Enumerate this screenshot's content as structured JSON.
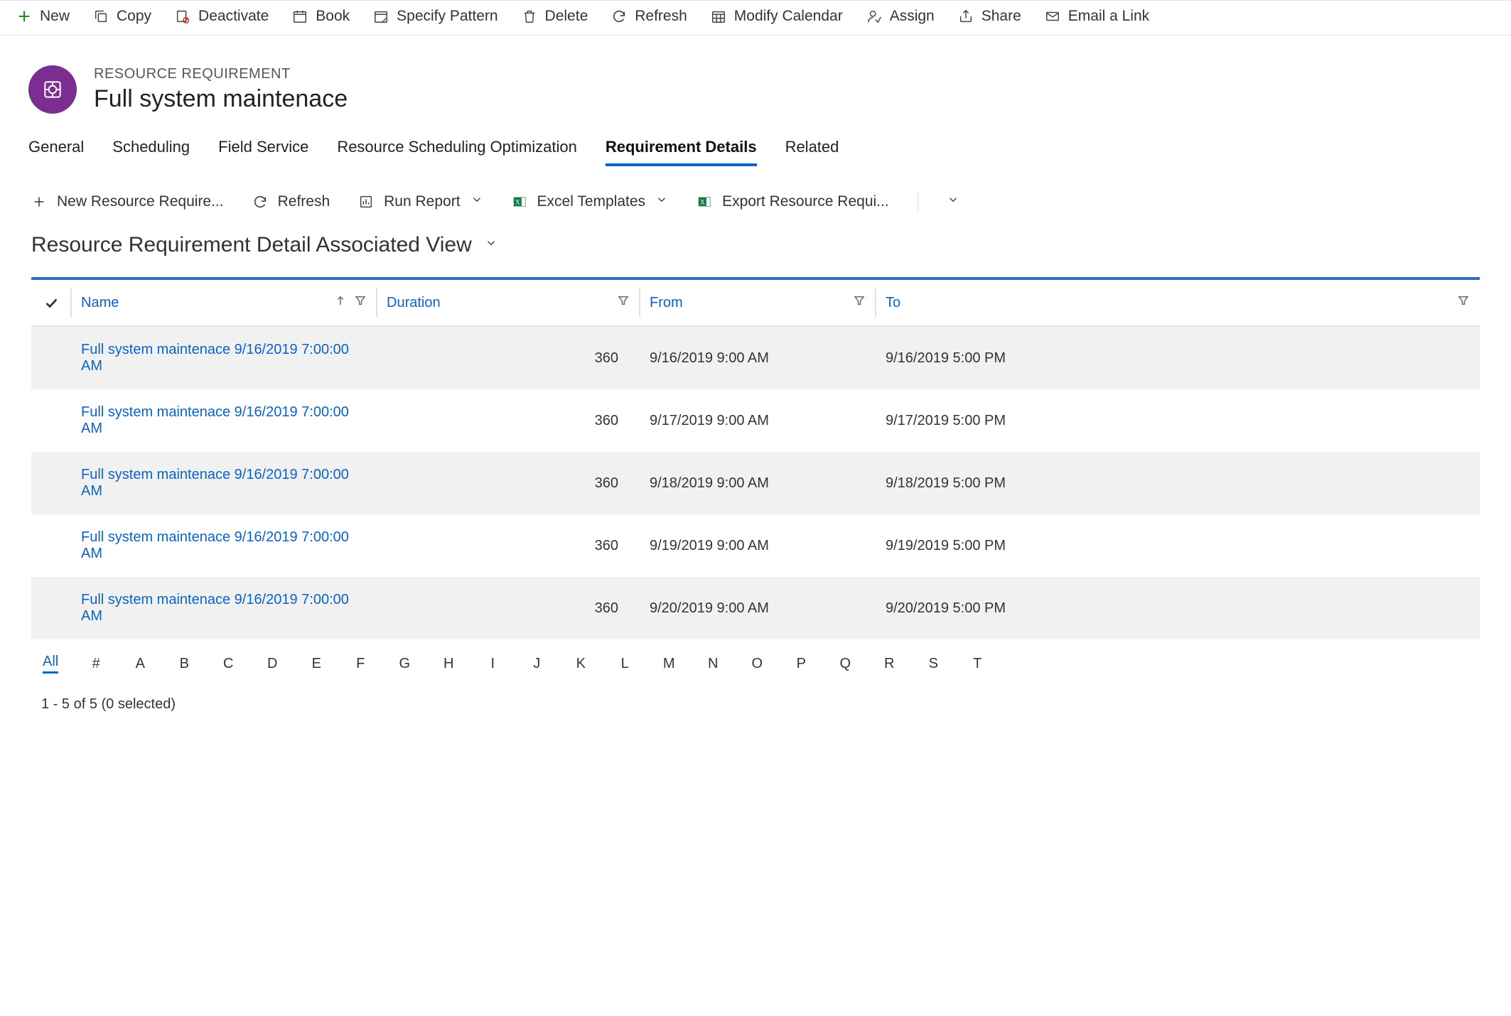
{
  "toolbar": {
    "new": "New",
    "copy": "Copy",
    "deactivate": "Deactivate",
    "book": "Book",
    "specify_pattern": "Specify Pattern",
    "delete": "Delete",
    "refresh": "Refresh",
    "modify_calendar": "Modify Calendar",
    "assign": "Assign",
    "share": "Share",
    "email_link": "Email a Link"
  },
  "record": {
    "entity_label": "RESOURCE REQUIREMENT",
    "name": "Full system maintenace"
  },
  "tabs": {
    "general": "General",
    "scheduling": "Scheduling",
    "field_service": "Field Service",
    "rso": "Resource Scheduling Optimization",
    "details": "Requirement Details",
    "related": "Related"
  },
  "subbar": {
    "new_requirement": "New Resource Require...",
    "refresh": "Refresh",
    "run_report": "Run Report",
    "excel_templates": "Excel Templates",
    "export": "Export Resource Requi..."
  },
  "view": {
    "title": "Resource Requirement Detail Associated View"
  },
  "columns": {
    "name": "Name",
    "duration": "Duration",
    "from": "From",
    "to": "To"
  },
  "rows": [
    {
      "name": "Full system maintenace 9/16/2019 7:00:00 AM",
      "duration": "360",
      "from": "9/16/2019 9:00 AM",
      "to": "9/16/2019 5:00 PM"
    },
    {
      "name": "Full system maintenace 9/16/2019 7:00:00 AM",
      "duration": "360",
      "from": "9/17/2019 9:00 AM",
      "to": "9/17/2019 5:00 PM"
    },
    {
      "name": "Full system maintenace 9/16/2019 7:00:00 AM",
      "duration": "360",
      "from": "9/18/2019 9:00 AM",
      "to": "9/18/2019 5:00 PM"
    },
    {
      "name": "Full system maintenace 9/16/2019 7:00:00 AM",
      "duration": "360",
      "from": "9/19/2019 9:00 AM",
      "to": "9/19/2019 5:00 PM"
    },
    {
      "name": "Full system maintenace 9/16/2019 7:00:00 AM",
      "duration": "360",
      "from": "9/20/2019 9:00 AM",
      "to": "9/20/2019 5:00 PM"
    }
  ],
  "alpha": {
    "all": "All",
    "hash": "#",
    "letters": [
      "A",
      "B",
      "C",
      "D",
      "E",
      "F",
      "G",
      "H",
      "I",
      "J",
      "K",
      "L",
      "M",
      "N",
      "O",
      "P",
      "Q",
      "R",
      "S",
      "T"
    ]
  },
  "footer": {
    "summary": "1 - 5 of 5 (0 selected)"
  }
}
